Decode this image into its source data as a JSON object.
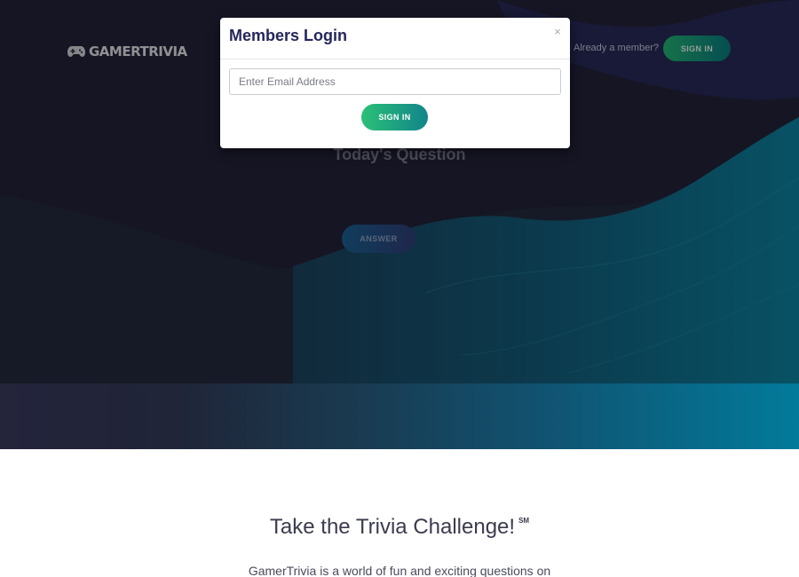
{
  "brand": {
    "name": "GAMERTRIVIA",
    "icon": "gamepad-icon"
  },
  "nav": {
    "member_prompt": "Already a member?",
    "signin_label": "SIGN IN"
  },
  "hero": {
    "question_heading": "Today's Question",
    "answer_label": "ANSWER"
  },
  "modal": {
    "title": "Members Login",
    "close_label": "×",
    "email_placeholder": "Enter Email Address",
    "email_value": "",
    "signin_label": "SIGN IN"
  },
  "section": {
    "heading": "Take the Trivia Challenge!",
    "heading_mark": "SM",
    "intro": "GamerTrivia is a world of fun and exciting questions on"
  },
  "colors": {
    "hero_dark": "#22233a",
    "wave_teal": "#0f7c9c",
    "button_green": "#24b876",
    "band_end": "#05c6fa",
    "modal_title": "#25265a"
  }
}
